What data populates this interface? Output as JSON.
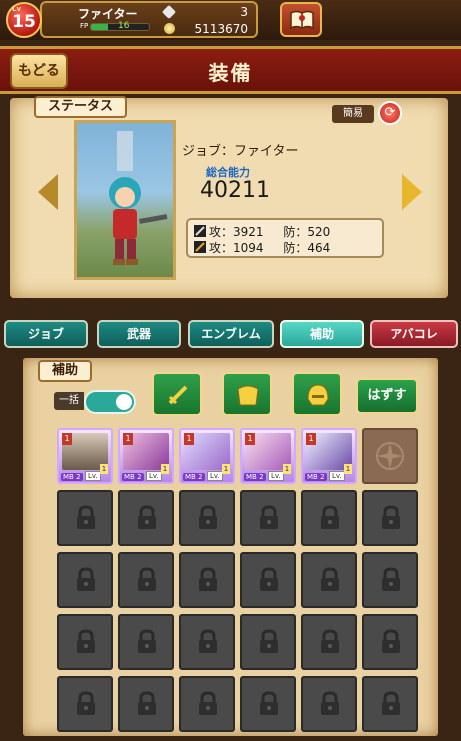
{
  "player": {
    "lv_tag": "Lv",
    "level": "15",
    "name": "ファイター",
    "fp_label": "FP",
    "fp_value": "16",
    "fp_fraction": 0.3,
    "gems": "3",
    "coins": "5113670"
  },
  "header": {
    "back_label": "もどる",
    "title": "装備"
  },
  "status": {
    "section_label": "ステータス",
    "simple_label": "簡易",
    "job_line": "ジョブ：ファイター",
    "power_label": "総合能力",
    "power_value": "40211",
    "physical_attack": "攻：3921",
    "physical_defense": "防：520",
    "magic_attack": "攻：1094",
    "magic_defense": "防：464"
  },
  "tabs": [
    {
      "label": "ジョブ"
    },
    {
      "label": "武器"
    },
    {
      "label": "エンブレム"
    },
    {
      "label": "補助"
    },
    {
      "label": "アバコレ"
    }
  ],
  "support": {
    "section_label": "補助",
    "bulk_label": "一括",
    "remove_label": "はずす",
    "cards": [
      {
        "mb": "MB 2",
        "lv": "Lv.",
        "lvn": "1",
        "cost": "1"
      },
      {
        "mb": "MB 2",
        "lv": "Lv.",
        "lvn": "1",
        "cost": "1"
      },
      {
        "mb": "MB 2",
        "lv": "Lv.",
        "lvn": "1",
        "cost": "1"
      },
      {
        "mb": "MB 2",
        "lv": "Lv.",
        "lvn": "1",
        "cost": "1"
      },
      {
        "mb": "MB 2",
        "lv": "Lv.",
        "lvn": "1",
        "cost": "1"
      }
    ]
  },
  "colors": {
    "title_bar": "#8c1d12",
    "tab_active": "#28a89a",
    "tab_teal": "#0f5f5a",
    "tab_red": "#8a1a24",
    "parchment": "#f0dcb0"
  }
}
